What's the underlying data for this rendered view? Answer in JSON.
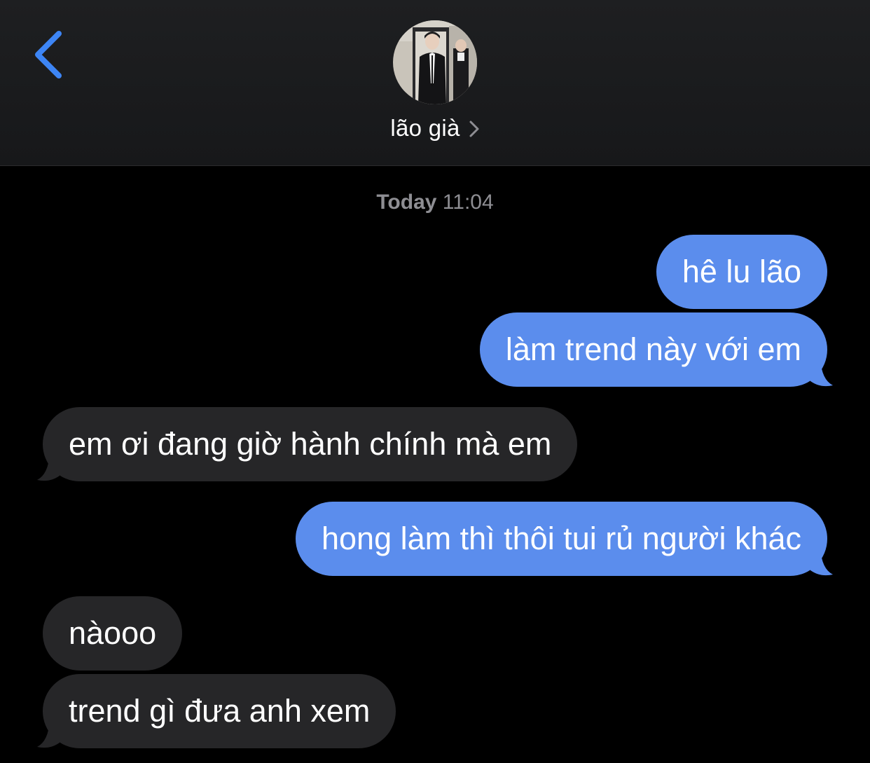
{
  "header": {
    "back_icon": "chevron-left-icon",
    "contact_name": "lão già",
    "detail_icon": "chevron-right-icon",
    "accent_color": "#3d85f5"
  },
  "conversation": {
    "timestamp_day": "Today",
    "timestamp_time": "11:04",
    "sent_bubble_color": "#5b8ded",
    "received_bubble_color": "#262628",
    "messages": [
      {
        "direction": "sent",
        "text": "hê lu lão"
      },
      {
        "direction": "sent",
        "text": "làm trend này với em"
      },
      {
        "direction": "received",
        "text": "em ơi đang giờ hành chính mà em"
      },
      {
        "direction": "sent",
        "text": "hong làm thì thôi tui rủ người khác"
      },
      {
        "direction": "received",
        "text": "nàooo"
      },
      {
        "direction": "received",
        "text": "trend gì đưa anh xem"
      }
    ]
  }
}
